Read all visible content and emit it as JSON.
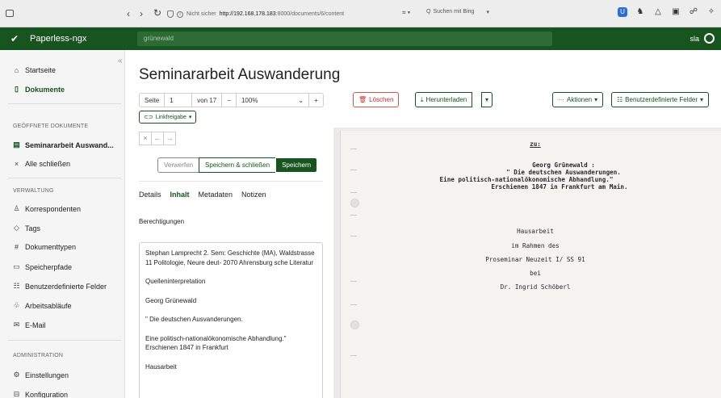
{
  "browser": {
    "url_security": "Nicht sicher",
    "url_host": "http://192.168.178.183",
    "url_path": ":8000/documents/6/content",
    "search_placeholder": "Suchen mit Bing"
  },
  "app": {
    "title": "Paperless-ngx",
    "search_value": "grünewald",
    "user": "sla",
    "brand_color": "#17541f"
  },
  "sidebar": {
    "items_top": [
      {
        "label": "Startseite",
        "icon": "home-icon"
      },
      {
        "label": "Dokumente",
        "icon": "document-icon"
      }
    ],
    "open_docs_heading": "GEÖFFNETE DOKUMENTE",
    "open_doc": "Seminararbeit Auswand...",
    "close_all": "Alle schließen",
    "manage_heading": "VERWALTUNG",
    "manage_items": [
      {
        "label": "Korrespondenten",
        "icon": "person-icon"
      },
      {
        "label": "Tags",
        "icon": "tag-icon"
      },
      {
        "label": "Dokumenttypen",
        "icon": "hash-icon"
      },
      {
        "label": "Speicherpfade",
        "icon": "folder-icon"
      },
      {
        "label": "Benutzerdefinierte Felder",
        "icon": "ui-checks-icon"
      },
      {
        "label": "Arbeitsabläufe",
        "icon": "workflow-icon"
      },
      {
        "label": "E-Mail",
        "icon": "envelope-icon"
      }
    ],
    "admin_heading": "ADMINISTRATION",
    "admin_items": [
      {
        "label": "Einstellungen",
        "icon": "gear-icon"
      },
      {
        "label": "Konfiguration",
        "icon": "sliders-icon"
      }
    ]
  },
  "document": {
    "title": "Seminararbeit Auswanderung",
    "page_label": "Seite",
    "page_value": "1",
    "page_of": "von 17",
    "zoom": "100%",
    "delete": "Löschen",
    "download": "Herunterladen",
    "actions": "Aktionen",
    "custom_fields": "Benutzerdefinierte Felder",
    "share_link": "Linkfreigabe",
    "discard": "Verwerfen",
    "save_close": "Speichern & schließen",
    "save": "Speichern",
    "tabs": [
      "Details",
      "Inhalt",
      "Metadaten",
      "Notizen"
    ],
    "permissions": "Berechtigungen",
    "content_paragraphs": [
      "Stephan Lamprecht 2. Sem: Geschichte (MA), Waldstrasse 11 Politologie, Neure deut- 2070 Ahrensburg sche Literatur",
      "Quelleninterpretation",
      "Georg Grünewald",
      "\" Die deutschen Ausvanderungen.",
      "Eine politisch-nationalökonomische Abhandlung.\" Erschienen 1847 in Frankfurt",
      "Hausarbeit"
    ]
  },
  "preview": {
    "lines": [
      "zu:",
      "Georg Grünewald :",
      "\" Die deutschen Auswanderungen.",
      "Eine politisch-nationalökonomische Abhandlung.\"",
      "Erschienen 1847 in Frankfurt am Main.",
      "Hausarbeit",
      "im Rahmen des",
      "Proseminar Neuzeit I/ SS 91",
      "bei",
      "Dr. Ingrid Schöberl"
    ]
  }
}
